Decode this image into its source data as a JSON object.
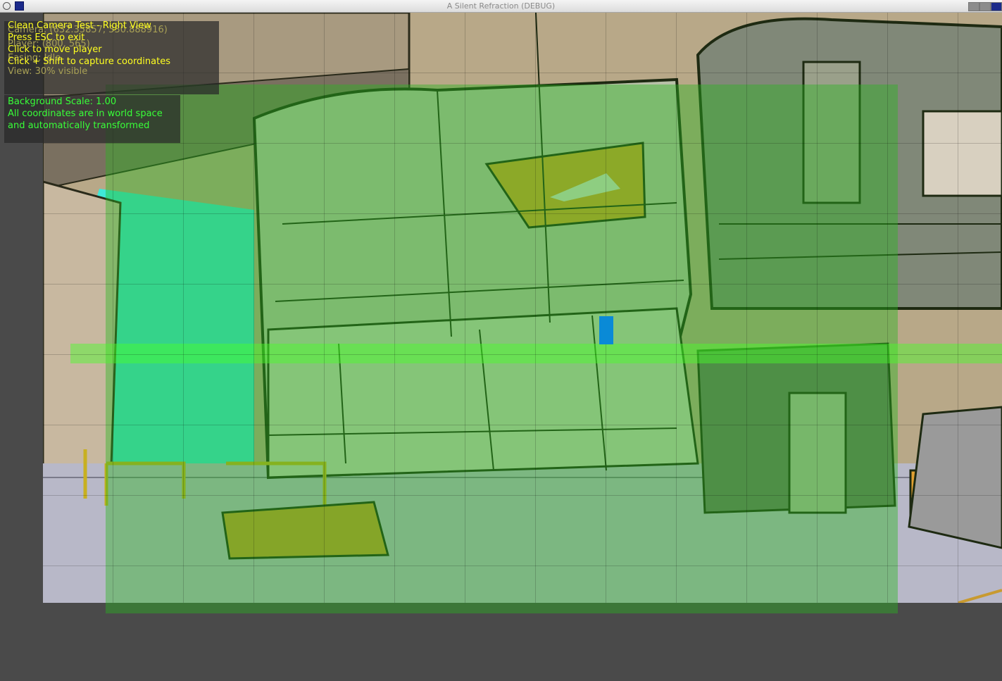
{
  "window": {
    "title": "A Silent Refraction (DEBUG)"
  },
  "hud": {
    "header_lines": [
      "Clean Camera Test - Right View",
      "Press ESC to exit",
      "Click to move player",
      "Click + Shift to capture coordinates"
    ],
    "ghost_lines": [
      "Camera: (632.35857, 330.888916)",
      "Player: (800, 565)",
      "Easing: Idle",
      "View: 30% visible"
    ],
    "info_lines": [
      "Background Scale: 1.00",
      "All coordinates are in world space",
      "and automatically transformed"
    ]
  },
  "colors": {
    "hud_text": "#ffff20",
    "info_text": "#38ff38",
    "walkable_overlay": "#28b41e",
    "player": "#0a8ad6",
    "sky": "#3fe8d8",
    "outline": "#2a3a1a"
  },
  "icons": [
    "debian-swirl-icon",
    "app-icon",
    "minimize-icon",
    "maximize-icon",
    "close-icon"
  ]
}
